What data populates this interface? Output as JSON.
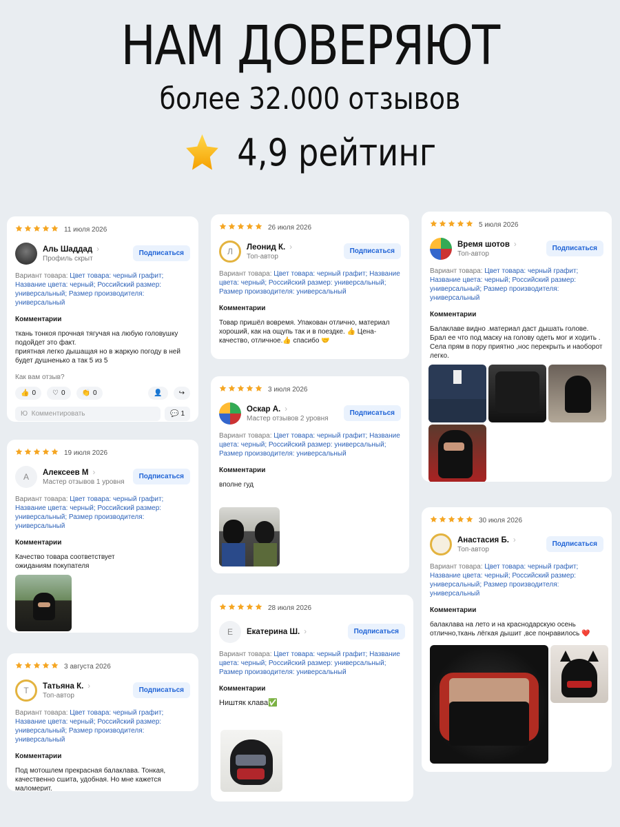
{
  "hero": {
    "title": "НАМ ДОВЕРЯЮТ",
    "subtitle": "более 32.000 отзывов",
    "rating": "4,9 рейтинг"
  },
  "labels": {
    "variant_prefix": "Вариант товара:",
    "comments_title": "Комментарии",
    "subscribe": "Подписаться",
    "how_review": "Как вам отзыв?",
    "comment_placeholder": "Комментировать"
  },
  "reviews": [
    {
      "date": "11 июля 2026",
      "name": "Аль Шаддад",
      "status": "Профиль скрыт",
      "variant": "Цвет товара: черный графит; Название цвета: черный; Российский размер: универсальный; Размер производителя: универсальный",
      "comment": "ткань тонкоя прочная тягучая на любую головушку подойдет это факт.\nприятная легко дышащая но в жаркую погоду в ней будет душненько а так 5 из 5",
      "likes": "0",
      "hearts": "0",
      "claps": "0",
      "comment_count": "1",
      "input_initial": "Ю"
    },
    {
      "date": "19 июля 2026",
      "name": "Алексеев М",
      "status": "Мастер отзывов 1 уровня",
      "avatar_letter": "А",
      "variant": "Цвет товара: черный графит; Название цвета: черный; Российский размер: универсальный; Размер производителя: универсальный",
      "comment": "Качество товара соответствует ожиданиям покупателя"
    },
    {
      "date": "3 августа 2026",
      "name": "Татьяна К.",
      "status": "Топ-автор",
      "avatar_letter": "Т",
      "variant": "Цвет товара: черный графит; Название цвета: черный; Российский размер: универсальный; Размер производителя: универсальный",
      "comment": "Под мотошлем прекрасная балаклава. Тонкая, качественно сшита, удобная. Но мне кажется маломерит."
    },
    {
      "date": "26 июля 2026",
      "name": "Леонид К.",
      "status": "Топ-автор",
      "avatar_letter": "Л",
      "variant": "Цвет товара: черный графит; Название цвета: черный; Российский размер: универсальный; Размер производителя: универсальный",
      "comment": "Товар пришёл вовремя. Упакован отлично, материал хороший, как на ощупь так и в поездке. 👍 Цена-качество, отличное.👍 спасибо 🤝"
    },
    {
      "date": "3 июля 2026",
      "name": "Оскар А.",
      "status": "Мастер отзывов 2 уровня",
      "variant": "Цвет товара: черный графит; Название цвета: черный; Российский размер: универсальный; Размер производителя: универсальный",
      "comment": "вполне гуд"
    },
    {
      "date": "28 июля 2026",
      "name": "Екатерина Ш.",
      "status": "",
      "avatar_letter": "Е",
      "variant": "Цвет товара: черный графит; Название цвета: черный; Российский размер: универсальный; Размер производителя: универсальный",
      "comment": "Ништяк клава✅"
    },
    {
      "date": "5 июля 2026",
      "name": "Время шотов",
      "status": "Топ-автор",
      "variant": "Цвет товара: черный графит; Название цвета: черный; Российский размер: универсальный; Размер производителя: универсальный",
      "comment": "Балаклаве видно .материал даст дышать голове. Брал ее что под маску на голову одеть мог и ходить .  Села прям в пору приятно ,нос перекрыть и наоборот легко."
    },
    {
      "date": "30 июля 2026",
      "name": "Анастасия Б.",
      "status": "Топ-автор",
      "variant": "Цвет товара: черный графит; Название цвета: черный; Российский размер: универсальный; Размер производителя: универсальный",
      "comment": "балаклава на лето и на краснодарскую осень отлично,ткань лёгкая дышит ,все понравилось ❤️"
    }
  ],
  "colors": {
    "star": "#f5a623",
    "link": "#2d62b8",
    "button_text": "#1f63d6",
    "button_bg": "#eaf2fd",
    "background": "#e9edf1"
  }
}
